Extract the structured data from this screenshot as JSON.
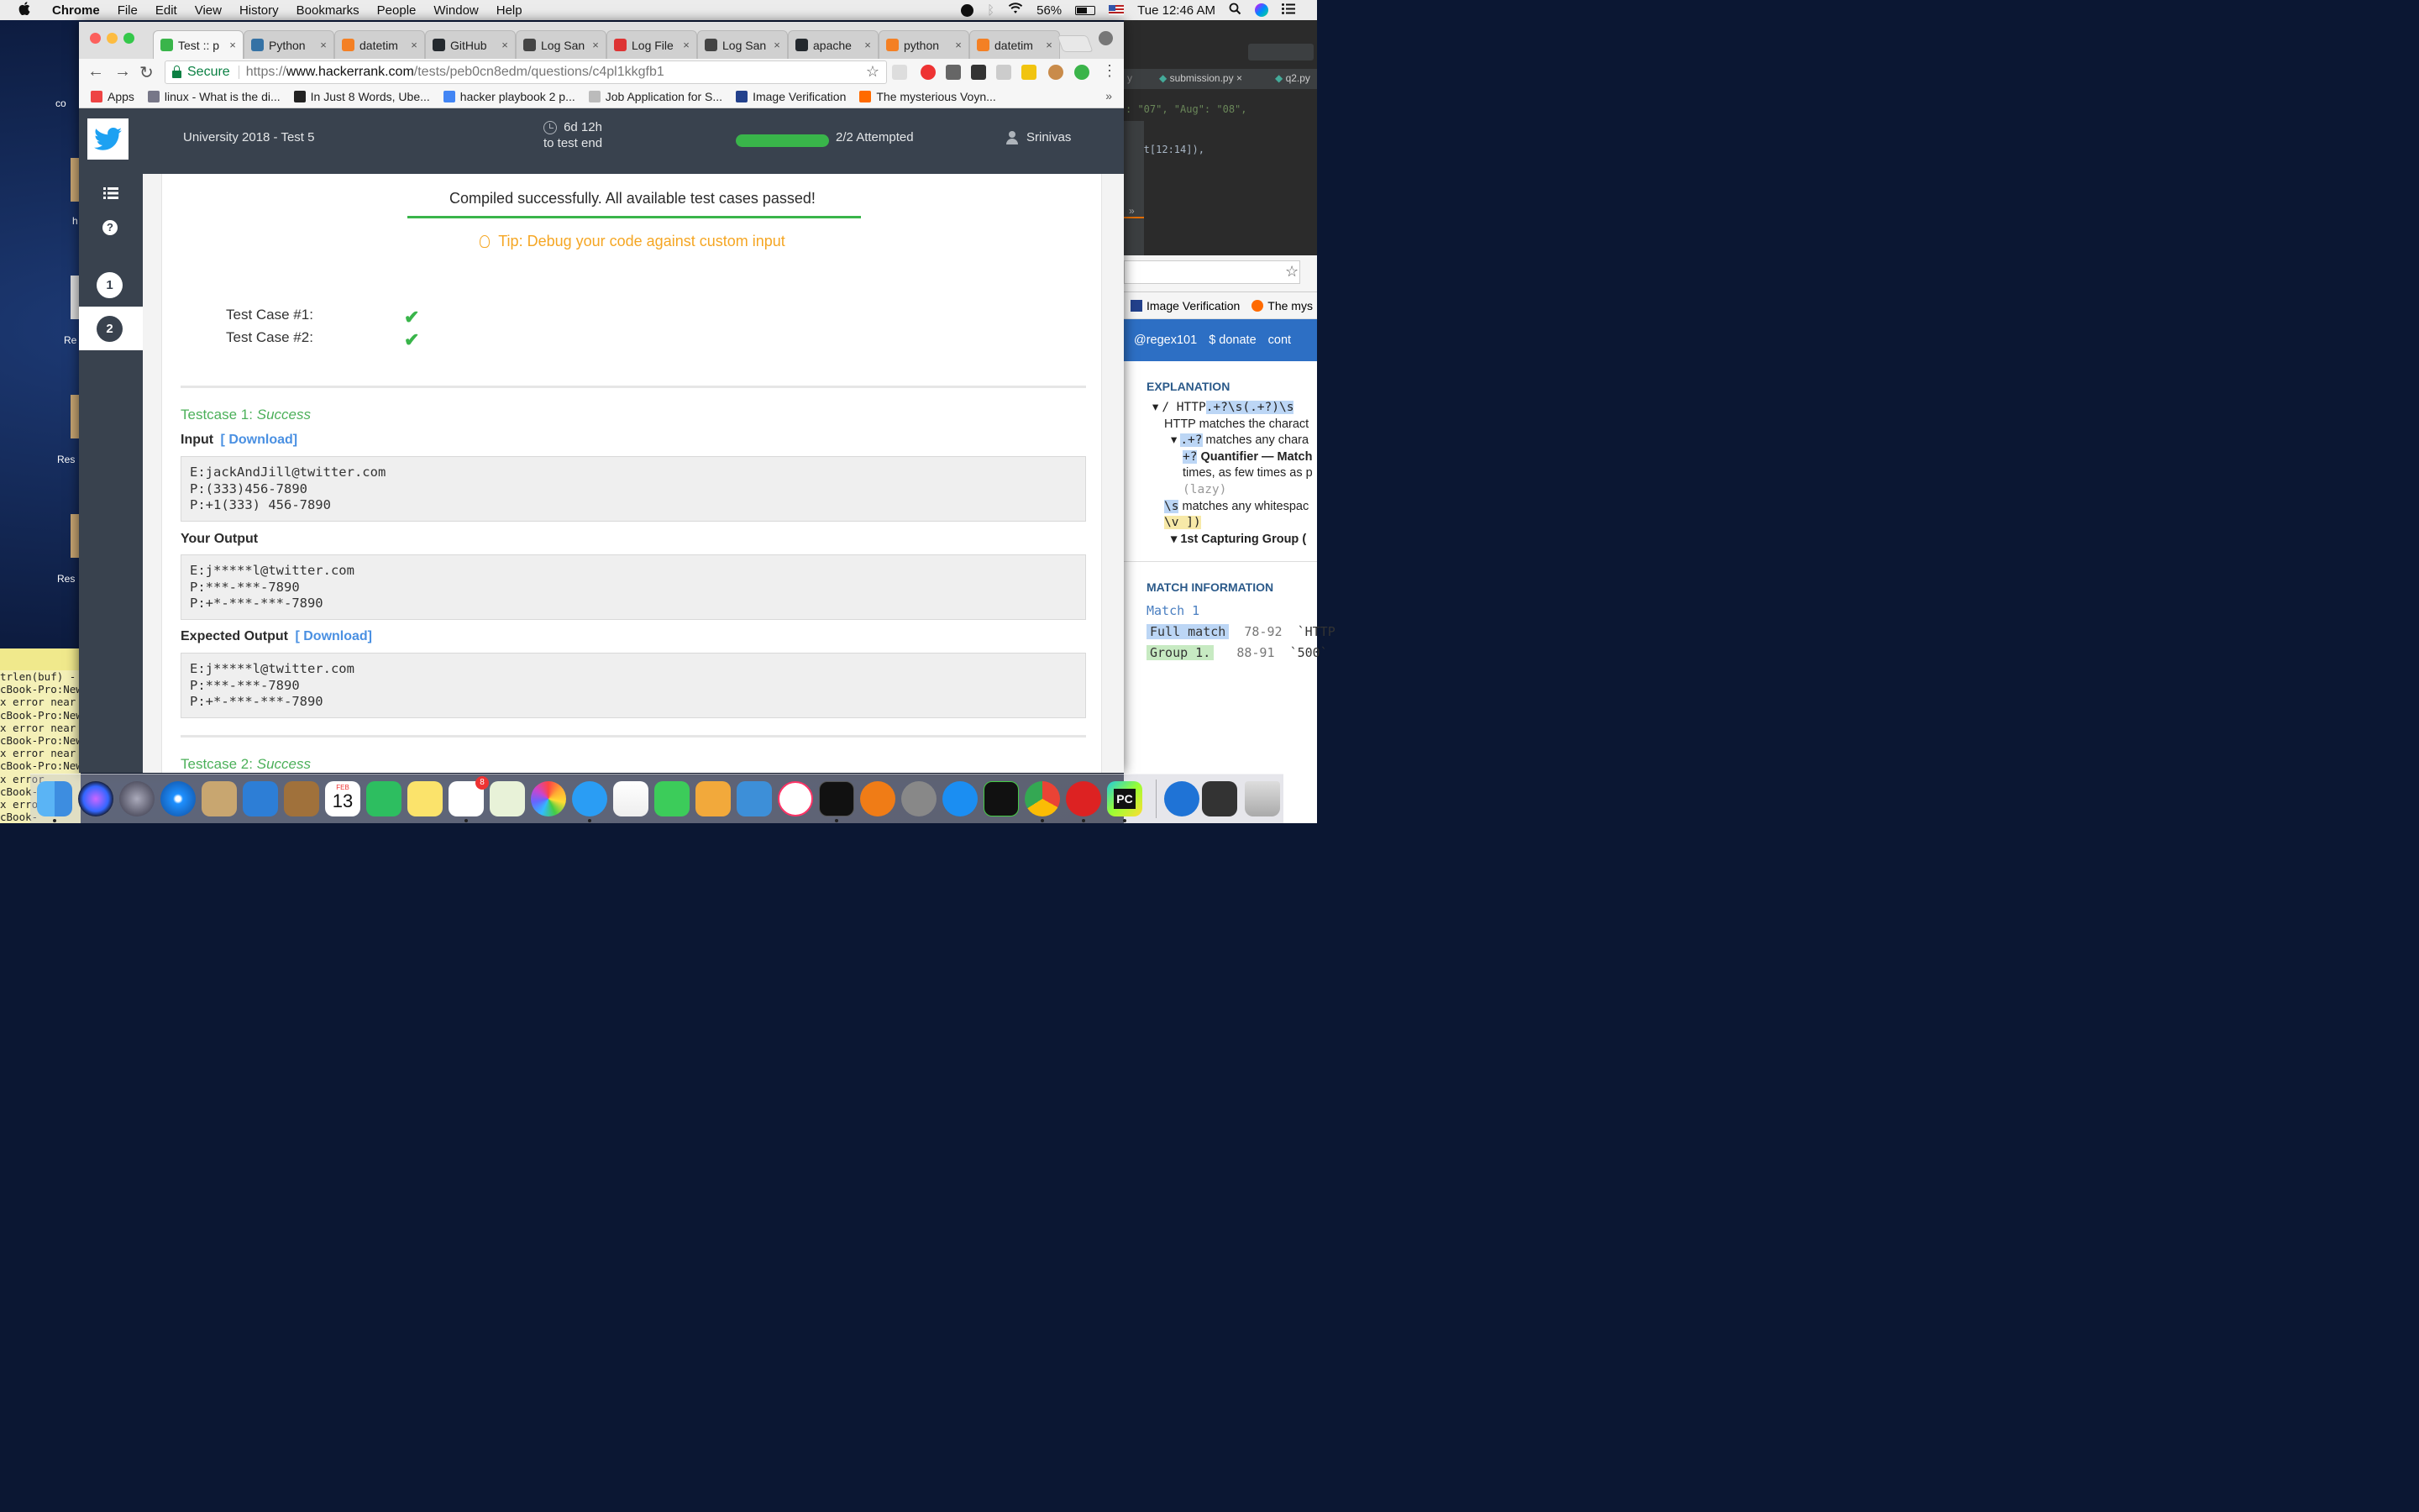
{
  "menubar": {
    "app": "Chrome",
    "menus": [
      "File",
      "Edit",
      "View",
      "History",
      "Bookmarks",
      "People",
      "Window",
      "Help"
    ],
    "battery": "56%",
    "clock": "Tue 12:46 AM"
  },
  "browser": {
    "tabs": [
      {
        "label": "Test :: p",
        "active": true,
        "icon": "hackerrank-icon",
        "color": "#39b54a"
      },
      {
        "label": "Python",
        "icon": "python-icon",
        "color": "#3572a5"
      },
      {
        "label": "datetim",
        "icon": "stackoverflow-icon",
        "color": "#f48024"
      },
      {
        "label": "GitHub",
        "icon": "github-icon",
        "color": "#24292e"
      },
      {
        "label": "Log San",
        "icon": "page-icon",
        "color": "#444"
      },
      {
        "label": "Log File",
        "icon": "slash-icon",
        "color": "#d33"
      },
      {
        "label": "Log San",
        "icon": "page-icon",
        "color": "#444"
      },
      {
        "label": "apache",
        "icon": "github-icon",
        "color": "#24292e"
      },
      {
        "label": "python",
        "icon": "stackoverflow-icon",
        "color": "#f48024"
      },
      {
        "label": "datetim",
        "icon": "stackoverflow-icon",
        "color": "#f48024"
      }
    ],
    "secure_label": "Secure",
    "url_scheme": "https://",
    "url_host": "www.hackerrank.com",
    "url_path": "/tests/peb0cn8edm/questions/c4pl1kkgfb1",
    "bookmarks": [
      {
        "label": "Apps",
        "color": "#e44"
      },
      {
        "label": "linux - What is the di...",
        "color": "#778"
      },
      {
        "label": "In Just 8 Words, Ube...",
        "color": "#222"
      },
      {
        "label": "hacker playbook 2 p...",
        "color": "#4285f4"
      },
      {
        "label": "Job Application for S...",
        "color": "#bbb"
      },
      {
        "label": "Image Verification",
        "color": "#23418c"
      },
      {
        "label": "The mysterious Voyn...",
        "color": "#ff6a00"
      }
    ]
  },
  "header": {
    "title": "University 2018 - Test 5",
    "time_left": "6d 12h",
    "time_caption": "to test end",
    "progress_fraction": 1.0,
    "attempted": "2/2 Attempted",
    "user": "Srinivas",
    "accent_color": "#39b54a"
  },
  "sidenav": {
    "question_1": "1",
    "question_2": "2"
  },
  "result": {
    "status": "Compiled successfully. All available test cases passed!",
    "tip": "Tip: Debug your code against custom input",
    "test_cases": [
      {
        "label": "Test Case #1:"
      },
      {
        "label": "Test Case #2:"
      }
    ],
    "testcase1_title": "Testcase 1:",
    "testcase1_status": "Success",
    "input_label": "Input",
    "download_label": "[ Download]",
    "input_text": "E:jackAndJill@twitter.com\nP:(333)456-7890\nP:+1(333) 456-7890",
    "your_output_label": "Your Output",
    "your_output_text": "E:j*****l@twitter.com\nP:***-***-7890\nP:+*-***-***-7890",
    "expected_output_label": "Expected Output",
    "expected_output_text": "E:j*****l@twitter.com\nP:***-***-7890\nP:+*-***-***-7890",
    "testcase2_title": "Testcase 2:",
    "testcase2_status": "Success"
  },
  "background": {
    "ide_tab1": "submission.py",
    "ide_tab2": "q2.py",
    "ide_line1": ": \"07\", \"Aug\": \"08\",",
    "ide_line2": "t(dt[12:14]),",
    "regex_bm1": "Image Verification",
    "regex_bm2": "The mys",
    "regex_link1": "@regex101",
    "regex_link2": "$ donate",
    "regex_link3": "cont",
    "explanation_heading": "EXPLANATION",
    "exp_l1_pre": "/ HTTP",
    "exp_l1_hl": ".+?\\s(.+?)\\s",
    "exp_l2": "HTTP matches the charact",
    "exp_l3_code": ".+?",
    "exp_l3": " matches any chara",
    "exp_l4_code": "+?",
    "exp_l4": " Quantifier — Match",
    "exp_l5": "times, as few times as p",
    "exp_l6": "(lazy)",
    "exp_l7_code": "\\s",
    "exp_l7": " matches any whitespac",
    "exp_l8": "\\v ])",
    "exp_l9": "1st Capturing Group (",
    "match_heading": "MATCH INFORMATION",
    "match_label": "Match 1",
    "full_match_label": "Full match",
    "full_match_range": "78-92",
    "full_match_value": "`HTTP",
    "group_label": "Group 1.",
    "group_range": "88-91",
    "group_value": "`500`",
    "terminal_text": "trlen(buf) -\ncBook-Pro:New\nx error near\ncBook-Pro:New\nx error near\ncBook-Pro:New\nx error near\ncBook-Pro:New\nx error\ncBook-\nx erro\ncBook-",
    "desk_label1": "co",
    "desk_label2": "h",
    "desk_label3": "Re",
    "desk_label4": "Res",
    "desk_label5": "Res"
  },
  "dock": {
    "calendar_month": "FEB",
    "calendar_day": "13",
    "reminders_badge": "8",
    "pycharm_label": "PC"
  }
}
